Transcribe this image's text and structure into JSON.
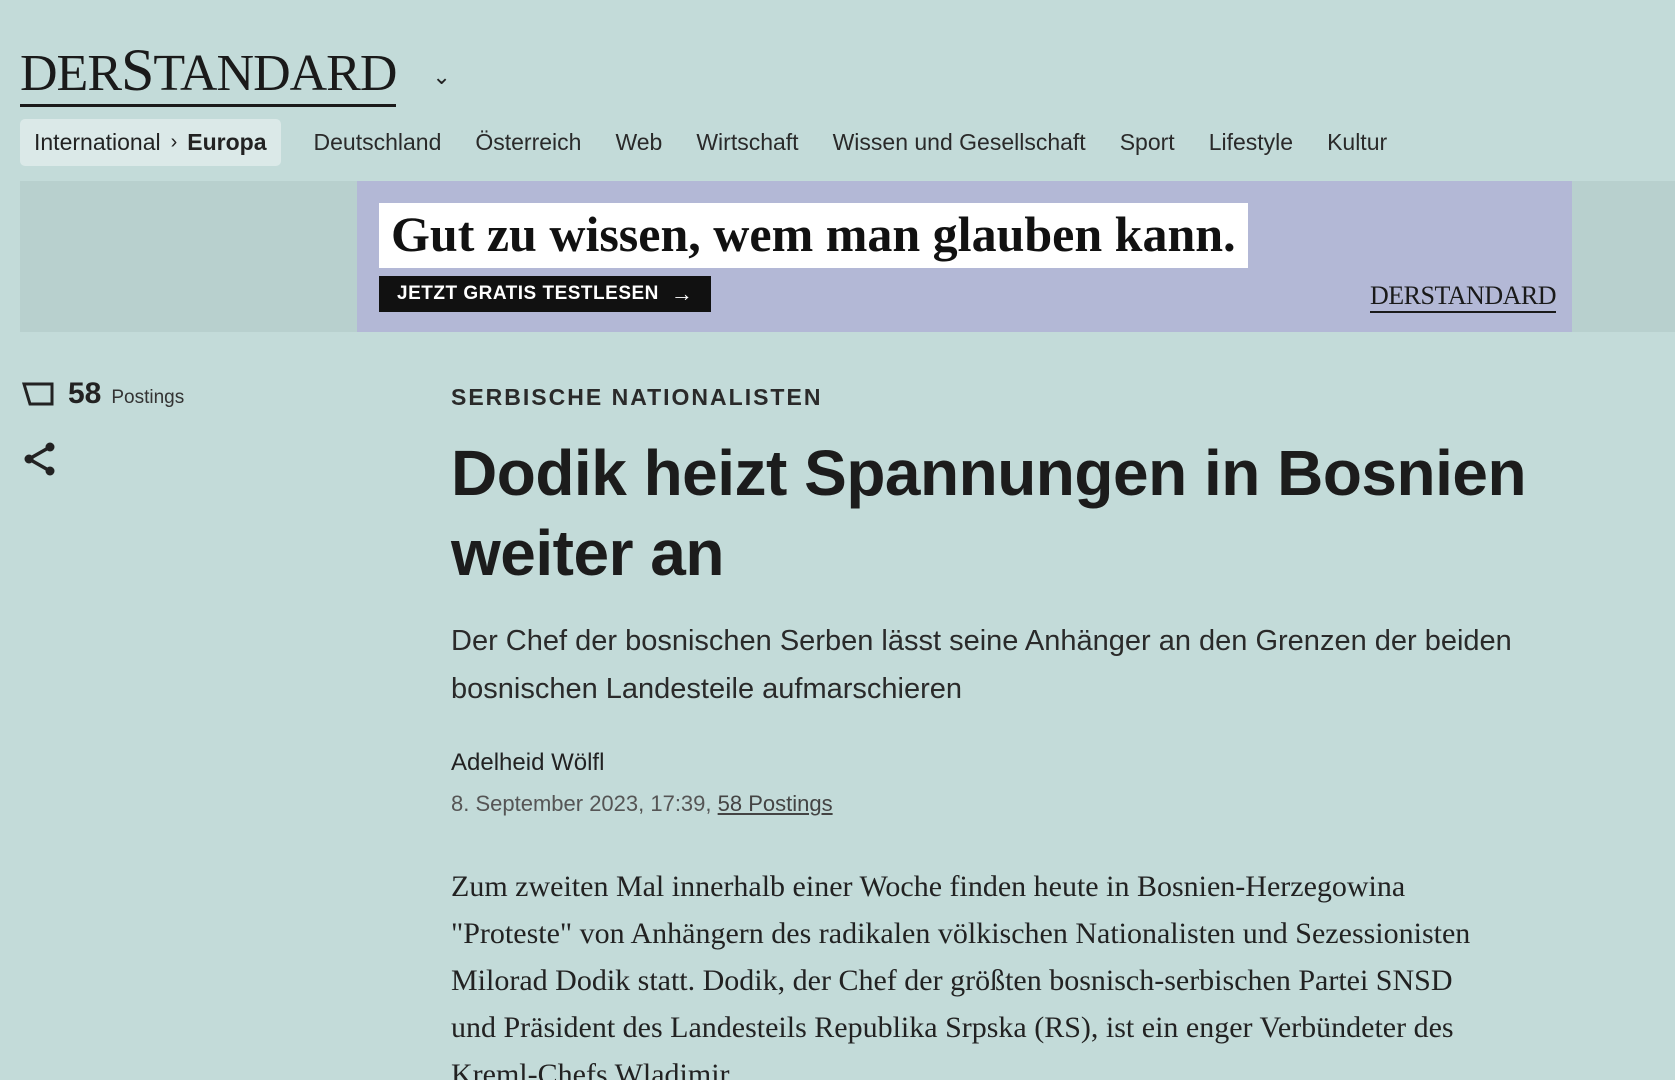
{
  "header": {
    "logo_left": "DER",
    "logo_s": "S",
    "logo_right": "TANDARD",
    "chevron": "⌄"
  },
  "nav": {
    "breadcrumb_parent": "International",
    "breadcrumb_sep": "›",
    "breadcrumb_current": "Europa",
    "items": [
      "Deutschland",
      "Österreich",
      "Web",
      "Wirtschaft",
      "Wissen und Gesellschaft",
      "Sport",
      "Lifestyle",
      "Kultur"
    ]
  },
  "ad": {
    "headline": "Gut zu wissen, wem man glauben kann.",
    "button": "JETZT GRATIS TESTLESEN",
    "button_arrow": "→",
    "logo": "DERSTANDARD"
  },
  "tools": {
    "postings_count": "58",
    "postings_label": "Postings",
    "comment_icon": "comment-icon",
    "share_icon": "share-icon"
  },
  "article": {
    "kicker": "SERBISCHE NATIONALISTEN",
    "title": "Dodik heizt Spannungen in Bosnien weiter an",
    "lead": "Der Chef der bosnischen Serben lässt seine Anhänger an den Grenzen der beiden bosnischen Landesteile aufmarschieren",
    "author": "Adelheid Wölfl",
    "date": "8. September 2023, 17:39, ",
    "postings_link": "58 Postings",
    "body": "Zum zweiten Mal innerhalb einer Woche finden heute in Bosnien-Herzegowina \"Proteste\" von Anhängern des radikalen völkischen Nationalisten und Sezessionisten Milorad Dodik statt. Dodik, der Chef der größten bosnisch-serbischen Partei SNSD und Präsident des Landesteils Republika Srpska (RS), ist ein enger Verbündeter des Kreml-Chefs Wladimir"
  },
  "colors": {
    "background": "#c3dbd9",
    "ad_background": "#b3b8d6",
    "text": "#1f1f1f"
  }
}
